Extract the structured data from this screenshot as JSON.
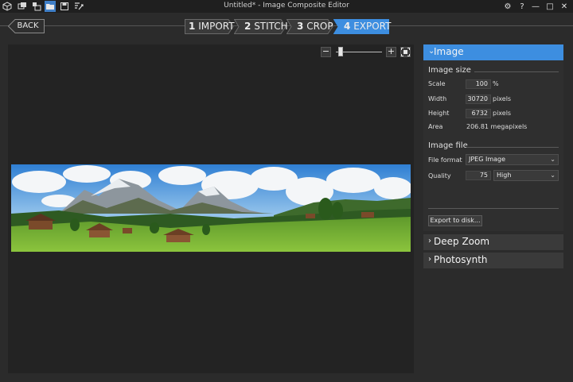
{
  "titlebar": {
    "title": "Untitled* - Image Composite Editor",
    "icons": [
      "cube-icon",
      "new-panorama-icon",
      "new-panorama-video-icon",
      "open-folder-icon",
      "save-icon",
      "publish-icon"
    ],
    "controls": {
      "settings": "⚙",
      "help": "?",
      "minimize": "—",
      "maximize": "□",
      "close": "✕"
    }
  },
  "nav": {
    "back_label": "BACK",
    "steps": [
      {
        "num": "1",
        "label": "IMPORT"
      },
      {
        "num": "2",
        "label": "STITCH"
      },
      {
        "num": "3",
        "label": "CROP"
      },
      {
        "num": "4",
        "label": "EXPORT"
      }
    ],
    "active_step": "4",
    "accent_color": "#3d8ee0"
  },
  "zoom": {
    "minus": "−",
    "plus": "+",
    "level": 0.05
  },
  "panel": {
    "image": {
      "title": "Image",
      "size_title": "Image size",
      "scale_label": "Scale",
      "scale_value": "100",
      "scale_unit": "%",
      "width_label": "Width",
      "width_value": "30720",
      "width_unit": "pixels",
      "height_label": "Height",
      "height_value": "6732",
      "height_unit": "pixels",
      "area_label": "Area",
      "area_value": "206.81 megapixels",
      "file_title": "Image file",
      "format_label": "File format",
      "format_value": "JPEG Image",
      "quality_label": "Quality",
      "quality_value": "75",
      "quality_preset": "High",
      "export_label": "Export to disk..."
    },
    "deep_zoom": {
      "title": "Deep Zoom"
    },
    "photosynth": {
      "title": "Photosynth"
    }
  }
}
